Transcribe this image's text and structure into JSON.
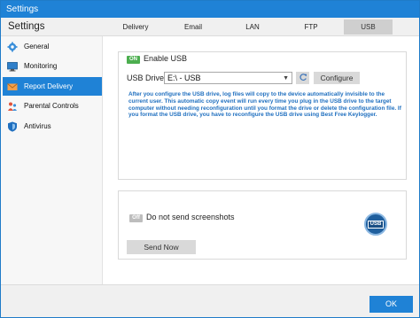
{
  "window": {
    "title": "Settings"
  },
  "header": {
    "app_title": "Settings",
    "tabs": [
      {
        "label": "Delivery"
      },
      {
        "label": "Email"
      },
      {
        "label": "LAN"
      },
      {
        "label": "FTP"
      },
      {
        "label": "USB",
        "active": true
      }
    ]
  },
  "sidebar": {
    "items": [
      {
        "label": "General",
        "icon": "gear-icon"
      },
      {
        "label": "Monitoring",
        "icon": "monitor-icon"
      },
      {
        "label": "Report Delivery",
        "icon": "envelope-icon",
        "active": true
      },
      {
        "label": "Parental Controls",
        "icon": "parental-icon"
      },
      {
        "label": "Antivirus",
        "icon": "shield-icon"
      }
    ]
  },
  "usb": {
    "enable_toggle": "ON",
    "enable_label": "Enable USB",
    "drive_label": "USB Drive",
    "drive_value": "E:\\ - USB",
    "configure_label": "Configure",
    "info": "After you configure the USB drive, log files will copy to the device automatically invisible to the current user. This automatic copy event will run every time you plug in the USB drive to the target computer without needing reconfiguration until you format the drive or delete the configuration file. If you format the USB drive, you have to reconfigure the USB drive using Best Free Keylogger."
  },
  "screenshots": {
    "toggle": "Off",
    "label": "Do not send screenshots",
    "send_now": "Send Now",
    "badge": "USB"
  },
  "footer": {
    "ok_label": "OK"
  },
  "colors": {
    "accent": "#1f82d6",
    "toggle_on": "#4cae4f",
    "info_text": "#1f6fbf"
  }
}
